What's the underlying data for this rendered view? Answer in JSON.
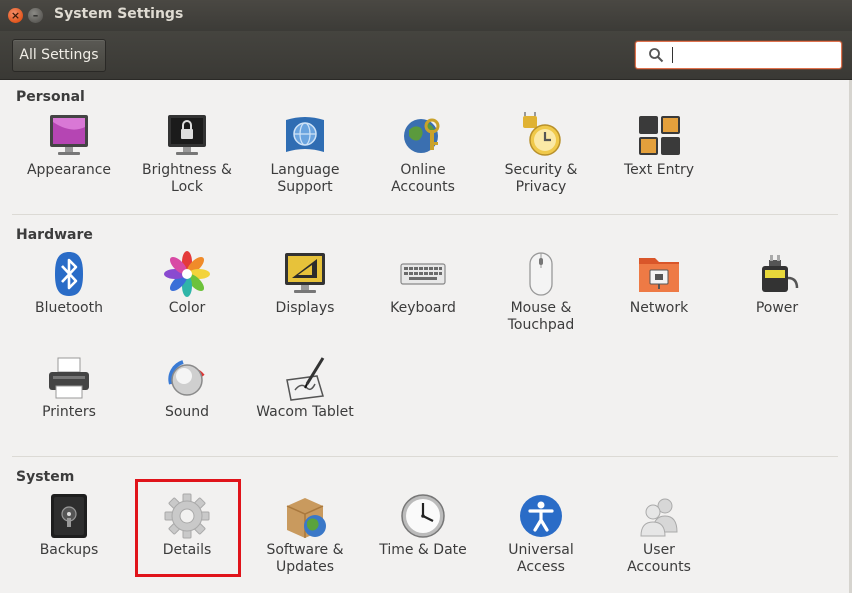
{
  "window": {
    "title": "System Settings",
    "close_glyph": "×",
    "min_glyph": "–"
  },
  "toolbar": {
    "all_settings_label": "All Settings",
    "search_value": "",
    "search_placeholder": ""
  },
  "sections": {
    "personal": {
      "title": "Personal",
      "items": [
        {
          "label": "Appearance",
          "icon": "appearance-icon"
        },
        {
          "label": "Brightness &\nLock",
          "icon": "brightness-lock-icon"
        },
        {
          "label": "Language\nSupport",
          "icon": "language-support-icon"
        },
        {
          "label": "Online\nAccounts",
          "icon": "online-accounts-icon"
        },
        {
          "label": "Security &\nPrivacy",
          "icon": "security-privacy-icon"
        },
        {
          "label": "Text Entry",
          "icon": "text-entry-icon"
        }
      ]
    },
    "hardware": {
      "title": "Hardware",
      "items": [
        {
          "label": "Bluetooth",
          "icon": "bluetooth-icon"
        },
        {
          "label": "Color",
          "icon": "color-icon"
        },
        {
          "label": "Displays",
          "icon": "displays-icon"
        },
        {
          "label": "Keyboard",
          "icon": "keyboard-icon"
        },
        {
          "label": "Mouse &\nTouchpad",
          "icon": "mouse-icon"
        },
        {
          "label": "Network",
          "icon": "network-icon"
        },
        {
          "label": "Power",
          "icon": "power-icon"
        },
        {
          "label": "Printers",
          "icon": "printer-icon"
        },
        {
          "label": "Sound",
          "icon": "sound-icon"
        },
        {
          "label": "Wacom Tablet",
          "icon": "wacom-tablet-icon"
        }
      ]
    },
    "system": {
      "title": "System",
      "items": [
        {
          "label": "Backups",
          "icon": "backups-icon"
        },
        {
          "label": "Details",
          "icon": "details-icon"
        },
        {
          "label": "Software &\nUpdates",
          "icon": "software-updates-icon"
        },
        {
          "label": "Time & Date",
          "icon": "clock-icon"
        },
        {
          "label": "Universal\nAccess",
          "icon": "universal-access-icon"
        },
        {
          "label": "User\nAccounts",
          "icon": "user-accounts-icon"
        }
      ]
    }
  },
  "colors": {
    "accent": "#e95420",
    "highlight_box": "#e0131a",
    "titlebar": "#3c3b37"
  }
}
